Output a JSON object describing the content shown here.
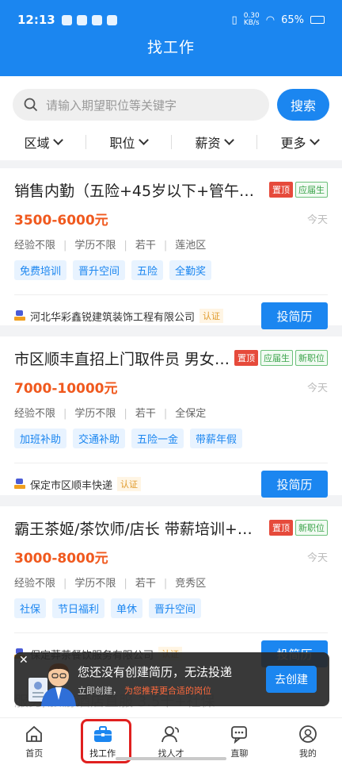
{
  "status": {
    "time": "12:13",
    "net_speed": "0.30\nKB/s",
    "battery": "65%"
  },
  "header": {
    "title": "找工作"
  },
  "search": {
    "placeholder": "请输入期望职位等关键字",
    "button": "搜索"
  },
  "filters": [
    "区域",
    "职位",
    "薪资",
    "更多"
  ],
  "jobs": [
    {
      "title": "销售内勤（五险+45岁以下+管午餐…",
      "tags": [
        "置顶",
        "应届生"
      ],
      "salary": "3500-6000元",
      "date": "今天",
      "reqs": [
        "经验不限",
        "学历不限",
        "若干",
        "莲池区"
      ],
      "welfare": [
        "免费培训",
        "晋升空间",
        "五险",
        "全勤奖"
      ],
      "company": "河北华彩鑫锐建筑装饰工程有限公司",
      "verify": "认证",
      "apply": "投简历"
    },
    {
      "title": "市区顺丰直招上门取件员 男女…",
      "tags": [
        "置顶",
        "应届生",
        "新职位"
      ],
      "salary": "7000-10000元",
      "date": "今天",
      "reqs": [
        "经验不限",
        "学历不限",
        "若干",
        "全保定"
      ],
      "welfare": [
        "加班补助",
        "交通补助",
        "五险一金",
        "带薪年假"
      ],
      "company": "保定市区顺丰快递",
      "verify": "认证",
      "apply": "投简历"
    },
    {
      "title": "霸王茶姬/茶饮师/店长 带薪培训+…",
      "tags": [
        "置顶",
        "新职位"
      ],
      "salary": "3000-8000元",
      "date": "今天",
      "reqs": [
        "经验不限",
        "学历不限",
        "若干",
        "竞秀区"
      ],
      "welfare": [
        "社保",
        "节日福利",
        "单休",
        "晋升空间"
      ],
      "company": "保定莽茶餐饮服务有限公司",
      "verify": "认证",
      "apply": "投简历"
    }
  ],
  "peek_text": "服务/旅游酒店直服 3.5千+社保",
  "banner": {
    "line1": "您还没有创建简历，无法投递",
    "line2a": "立即创建，",
    "line2b": "为您推荐更合适的岗位",
    "button": "去创建"
  },
  "tabs": [
    {
      "label": "首页",
      "icon": "home-icon"
    },
    {
      "label": "找工作",
      "icon": "briefcase-icon"
    },
    {
      "label": "找人才",
      "icon": "people-icon"
    },
    {
      "label": "直聊",
      "icon": "chat-icon"
    },
    {
      "label": "我的",
      "icon": "profile-icon"
    }
  ],
  "colors": {
    "primary": "#1b86f0",
    "salary": "#f0591e",
    "top_tag": "#e64a3b",
    "highlight": "#e0201f"
  }
}
